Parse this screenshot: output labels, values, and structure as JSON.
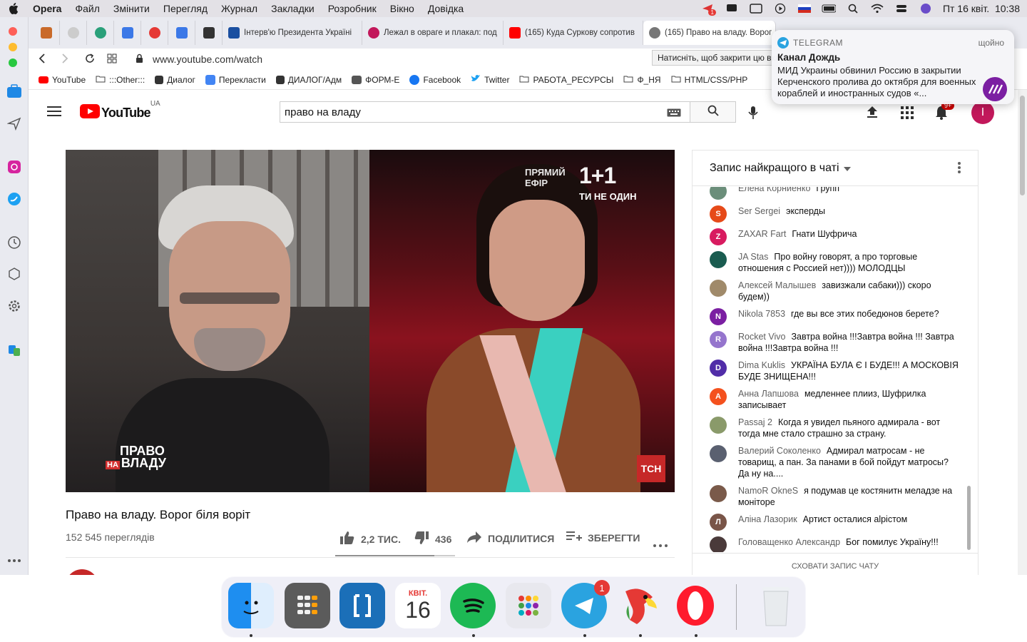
{
  "menubar": {
    "app_name": "Opera",
    "items": [
      "Файл",
      "Змінити",
      "Перегляд",
      "Журнал",
      "Закладки",
      "Розробник",
      "Вікно",
      "Довідка"
    ],
    "datetime": "Пт 16 квіт.  10:38",
    "badge": "1"
  },
  "tabs": [
    {
      "title": "Інтерв'ю Президента Україні"
    },
    {
      "title": "Лежал в овраге и плакал: под"
    },
    {
      "title": "(165) Куда Суркову сопротив"
    },
    {
      "title": "(165) Право на владу. Ворог"
    }
  ],
  "address": {
    "url": "www.youtube.com/watch"
  },
  "bookmarks": [
    "YouTube",
    ":::Other:::",
    "Диалог",
    "Перекласти",
    "ДИАЛОГ/Адм",
    "ФОРМ-Е",
    "Facebook",
    "Twitter",
    "РАБОТА_РЕСУРСЫ",
    "Ф_НЯ",
    "HTML/CSS/PHP"
  ],
  "youtube": {
    "logo_text": "YouTube",
    "region": "UA",
    "search_value": "право на владу",
    "notif_count": "9+",
    "avatar_letter": "I"
  },
  "video": {
    "title": "Право на владу. Ворог біля воріт",
    "views": "152 545 переглядів",
    "likes": "2,2 ТИС.",
    "dislikes": "436",
    "share_label": "ПОДІЛИТИСЯ",
    "save_label": "ЗБЕРЕГТИ",
    "overlay_show_line1": "ПРАВО",
    "overlay_show_na": "НА",
    "overlay_show_line2": "ВЛАДУ",
    "overlay_live_line1": "ПРЯМИЙ",
    "overlay_live_line2": "ЕФІР",
    "overlay_channel": "1+1",
    "overlay_slogan": "ТИ НЕ ОДИН",
    "overlay_tsn": "ТСН"
  },
  "chat": {
    "header": "Запис найкращого в чаті",
    "hide_label": "СХОВАТИ ЗАПИС ЧАТУ",
    "messages": [
      {
        "author": "Елена Корниенко",
        "text": "Групп",
        "initial": "",
        "color": "#6b8e7a"
      },
      {
        "author": "Ser Sergei",
        "text": "эксперды",
        "initial": "S",
        "color": "#e64a19"
      },
      {
        "author": "ZAXAR Fart",
        "text": "Гнати Шуфрича",
        "initial": "Z",
        "color": "#d81b60"
      },
      {
        "author": "JA Stas",
        "text": "Про войну говорят, а про торговые отношения с Россией нет)))) МОЛОДЦЫ",
        "initial": "",
        "color": "#1a5c50"
      },
      {
        "author": "Алексей Малышев",
        "text": "завизжали сабаки))) скоро будем))",
        "initial": "",
        "color": "#a08a6a"
      },
      {
        "author": "Nikola 7853",
        "text": "где вы все этих победюнов берете?",
        "initial": "N",
        "color": "#7b1fa2"
      },
      {
        "author": "Rocket Vivo",
        "text": "Завтра война !!!Завтра война !!! Завтра война !!!Завтра война !!!",
        "initial": "R",
        "color": "#9575cd"
      },
      {
        "author": "Dima Kuklis",
        "text": "УКРАЇНА БУЛА Є І БУДЕ!!! А МОСКОВІЯ БУДЕ ЗНИЩЕНА!!!",
        "initial": "D",
        "color": "#512da8"
      },
      {
        "author": "Анна Лапшова",
        "text": "медленнее плииз, Шуфрилка записывает",
        "initial": "A",
        "color": "#f4511e"
      },
      {
        "author": "Passaj 2",
        "text": "Когда я увидел пьяного адмирала - вот тогда мне стало страшно за страну.",
        "initial": "",
        "color": "#8a9a6a"
      },
      {
        "author": "Валерий Соколенко",
        "text": "Адмирал матросам - не товарищ, а пан. За панами в бой пойдут матросы? Да ну на....",
        "initial": "",
        "color": "#5a6070"
      },
      {
        "author": "NamoR OkneS",
        "text": "я подумав це костянитн меладзе на моніторе",
        "initial": "",
        "color": "#7a5a4a"
      },
      {
        "author": "Аліна Лазорик",
        "text": "Артист осталися аlрістом",
        "initial": "Л",
        "color": "#795548"
      },
      {
        "author": "Головащенко Александр",
        "text": "Бог помилує Україну!!!",
        "initial": "",
        "color": "#4a3a3a"
      }
    ]
  },
  "notification": {
    "app": "TELEGRAM",
    "time": "щойно",
    "title": "Канал Дождь",
    "body": "МИД Украины обвинил Россию в закрытии Керченского пролива до октября для военных кораблей и иностранных судов «..."
  },
  "tooltip": "Натисніть, щоб закрити цю вкладку",
  "dock": {
    "calendar_month": "КВІТ.",
    "calendar_day": "16",
    "telegram_badge": "1"
  }
}
